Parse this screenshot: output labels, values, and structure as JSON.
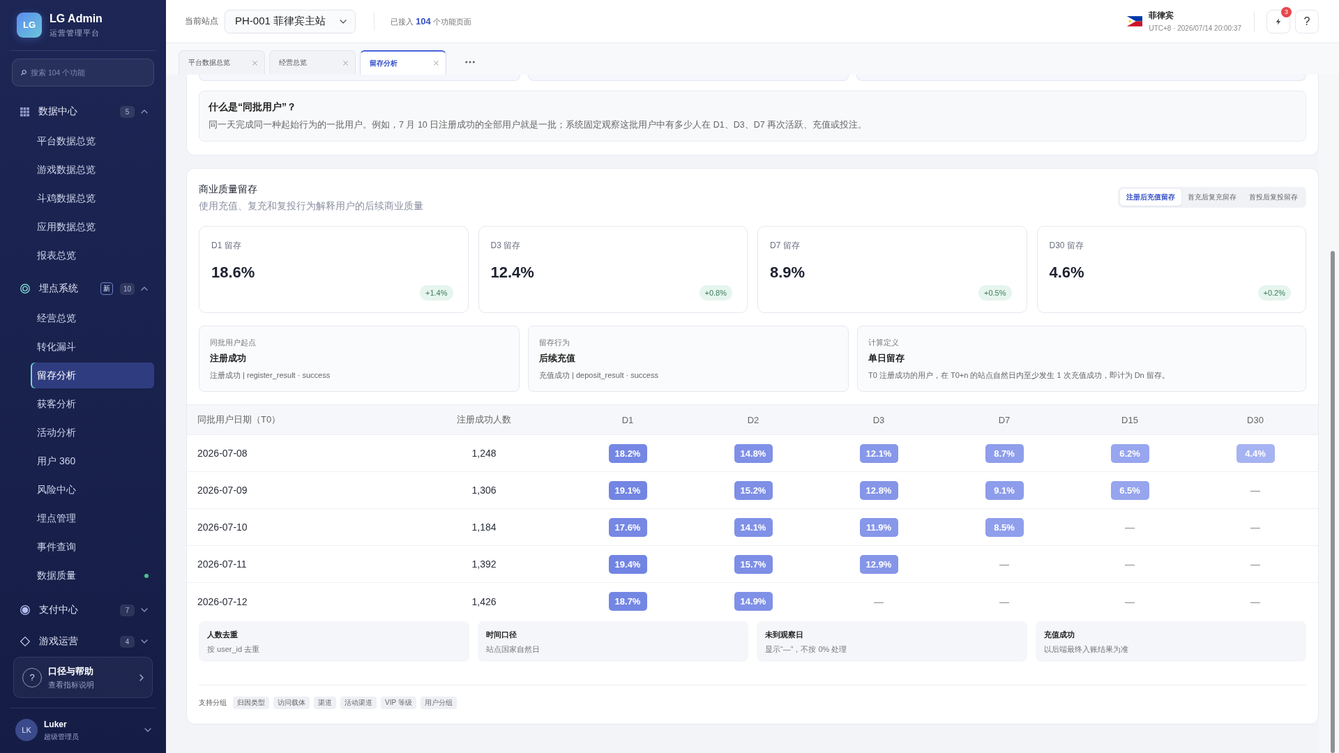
{
  "sidebar": {
    "logo": "LG",
    "app_name": "LG Admin",
    "app_subtitle": "运营管理平台",
    "search": {
      "placeholder": "搜索 104 个功能"
    },
    "groups": [
      {
        "label": "数据中心",
        "count": "5",
        "expanded": true,
        "children": [
          {
            "label": "平台数据总览",
            "selected": false,
            "status_dot": false
          },
          {
            "label": "游戏数据总览",
            "selected": false,
            "status_dot": false
          },
          {
            "label": "斗鸡数据总览",
            "selected": false,
            "status_dot": false
          },
          {
            "label": "应用数据总览",
            "selected": false,
            "status_dot": false
          },
          {
            "label": "报表总览",
            "selected": false,
            "status_dot": false
          }
        ]
      },
      {
        "label": "埋点系统",
        "tag": "新",
        "count": "10",
        "expanded": true,
        "children": [
          {
            "label": "经营总览",
            "selected": false,
            "status_dot": false
          },
          {
            "label": "转化漏斗",
            "selected": false,
            "status_dot": false
          },
          {
            "label": "留存分析",
            "selected": true,
            "status_dot": false
          },
          {
            "label": "获客分析",
            "selected": false,
            "status_dot": false
          },
          {
            "label": "活动分析",
            "selected": false,
            "status_dot": false
          },
          {
            "label": "用户 360",
            "selected": false,
            "status_dot": false
          },
          {
            "label": "风险中心",
            "selected": false,
            "status_dot": false
          },
          {
            "label": "埋点管理",
            "selected": false,
            "status_dot": false
          },
          {
            "label": "事件查询",
            "selected": false,
            "status_dot": false
          },
          {
            "label": "数据质量",
            "selected": false,
            "status_dot": true
          }
        ]
      },
      {
        "label": "支付中心",
        "count": "7",
        "expanded": false
      },
      {
        "label": "游戏运营",
        "count": "4",
        "expanded": false
      }
    ],
    "help_card": {
      "icon": "?",
      "title": "口径与帮助",
      "subtitle": "查看指标说明"
    },
    "user": {
      "initials": "LK",
      "name": "Luker",
      "role": "超级管理员"
    }
  },
  "top_bar": {
    "site_label": "当前站点",
    "site_select": {
      "value": "PH-001 菲律宾主站"
    },
    "connected_pages": "已接入 **104** 个功能页面",
    "region": {
      "name": "菲律宾",
      "time": "UTC+8 · 2026/07/14 20:00:37"
    },
    "notifications": {
      "count": "3"
    },
    "help_button": "?"
  },
  "tabs": [
    {
      "label": "平台数据总览",
      "selected": false
    },
    {
      "label": "经营总览",
      "selected": false
    },
    {
      "label": "留存分析",
      "selected": true
    }
  ],
  "cohort_definition": {
    "title": "什么是“同批用户”？",
    "description": "同一天完成同一种起始行为的一批用户。例如，7 月 10 日注册成功的全部用户就是一批；系统固定观察这批用户中有多少人在 D1、D3、D7 再次活跃、充值或投注。"
  },
  "retention_panel": {
    "title": "商业质量留存",
    "subtitle": "使用充值、复充和复投行为解释用户的后续商业质量",
    "modes": [
      {
        "label": "注册后充值留存",
        "selected": true
      },
      {
        "label": "首充后复充留存",
        "selected": false
      },
      {
        "label": "首投后复投留存",
        "selected": false
      }
    ],
    "kpis": [
      {
        "label": "D1 留存",
        "value": "18.6%",
        "delta": "+1.4%"
      },
      {
        "label": "D3 留存",
        "value": "12.4%",
        "delta": "+0.8%"
      },
      {
        "label": "D7 留存",
        "value": "8.9%",
        "delta": "+0.5%"
      },
      {
        "label": "D30 留存",
        "value": "4.6%",
        "delta": "+0.2%"
      }
    ],
    "definitions": [
      {
        "label": "同批用户起点",
        "title": "注册成功",
        "detail": "注册成功 | register_result · success"
      },
      {
        "label": "留存行为",
        "title": "后续充值",
        "detail": "充值成功 | deposit_result · success"
      },
      {
        "label": "计算定义",
        "title": "单日留存",
        "detail": "T0 注册成功的用户，在 T0+n 的站点自然日内至少发生 1 次充值成功，即计为 Dn 留存。"
      }
    ],
    "table": {
      "columns": [
        "同批用户日期（T0）",
        "注册成功人数",
        "D1",
        "D2",
        "D3",
        "D7",
        "D15",
        "D30"
      ],
      "rows": [
        {
          "date": "2026-07-08",
          "count": "1,248",
          "rates": [
            {
              "kind": "rate",
              "text": "18.2%",
              "color": "#7587e4"
            },
            {
              "kind": "rate",
              "text": "14.8%",
              "color": "#7f90e7"
            },
            {
              "kind": "rate",
              "text": "12.1%",
              "color": "#8797e9"
            },
            {
              "kind": "rate",
              "text": "8.7%",
              "color": "#8e9eeb"
            },
            {
              "kind": "rate",
              "text": "6.2%",
              "color": "#97a6ee"
            },
            {
              "kind": "rate",
              "text": "4.4%",
              "color": "#a6b3f2"
            }
          ]
        },
        {
          "date": "2026-07-09",
          "count": "1,306",
          "rates": [
            {
              "kind": "rate",
              "text": "19.1%",
              "color": "#7385e3"
            },
            {
              "kind": "rate",
              "text": "15.2%",
              "color": "#7e8fe6"
            },
            {
              "kind": "rate",
              "text": "12.8%",
              "color": "#8595e8"
            },
            {
              "kind": "rate",
              "text": "9.1%",
              "color": "#8d9deb"
            },
            {
              "kind": "rate",
              "text": "6.5%",
              "color": "#96a5ed"
            },
            {
              "kind": "empty",
              "text": "—"
            }
          ]
        },
        {
          "date": "2026-07-10",
          "count": "1,184",
          "rates": [
            {
              "kind": "rate",
              "text": "17.6%",
              "color": "#7688e4"
            },
            {
              "kind": "rate",
              "text": "14.1%",
              "color": "#8091e7"
            },
            {
              "kind": "rate",
              "text": "11.9%",
              "color": "#8797e9"
            },
            {
              "kind": "rate",
              "text": "8.5%",
              "color": "#8f9fec"
            },
            {
              "kind": "empty",
              "text": "—"
            },
            {
              "kind": "empty",
              "text": "—"
            }
          ]
        },
        {
          "date": "2026-07-11",
          "count": "1,392",
          "rates": [
            {
              "kind": "rate",
              "text": "19.4%",
              "color": "#7284e3"
            },
            {
              "kind": "rate",
              "text": "15.7%",
              "color": "#7d8ee6"
            },
            {
              "kind": "rate",
              "text": "12.9%",
              "color": "#8595e8"
            },
            {
              "kind": "empty",
              "text": "—"
            },
            {
              "kind": "empty",
              "text": "—"
            },
            {
              "kind": "empty",
              "text": "—"
            }
          ]
        },
        {
          "date": "2026-07-12",
          "count": "1,426",
          "rates": [
            {
              "kind": "rate",
              "text": "18.7%",
              "color": "#7486e4"
            },
            {
              "kind": "rate",
              "text": "14.9%",
              "color": "#7f90e7"
            },
            {
              "kind": "empty",
              "text": "—"
            },
            {
              "kind": "empty",
              "text": "—"
            },
            {
              "kind": "empty",
              "text": "—"
            },
            {
              "kind": "empty",
              "text": "—"
            }
          ]
        }
      ]
    },
    "notes": [
      {
        "title": "人数去重",
        "text": "按 user_id 去重"
      },
      {
        "title": "时间口径",
        "text": "站点国家自然日"
      },
      {
        "title": "未到观察日",
        "text": "显示“—”，不按 0% 处理"
      },
      {
        "title": "充值成功",
        "text": "以后端最终入账结果为准"
      }
    ],
    "grouping": {
      "label": "支持分组",
      "tags": [
        "归因类型",
        "访问载体",
        "渠道",
        "活动渠道",
        "VIP 等级",
        "用户分组"
      ]
    }
  }
}
